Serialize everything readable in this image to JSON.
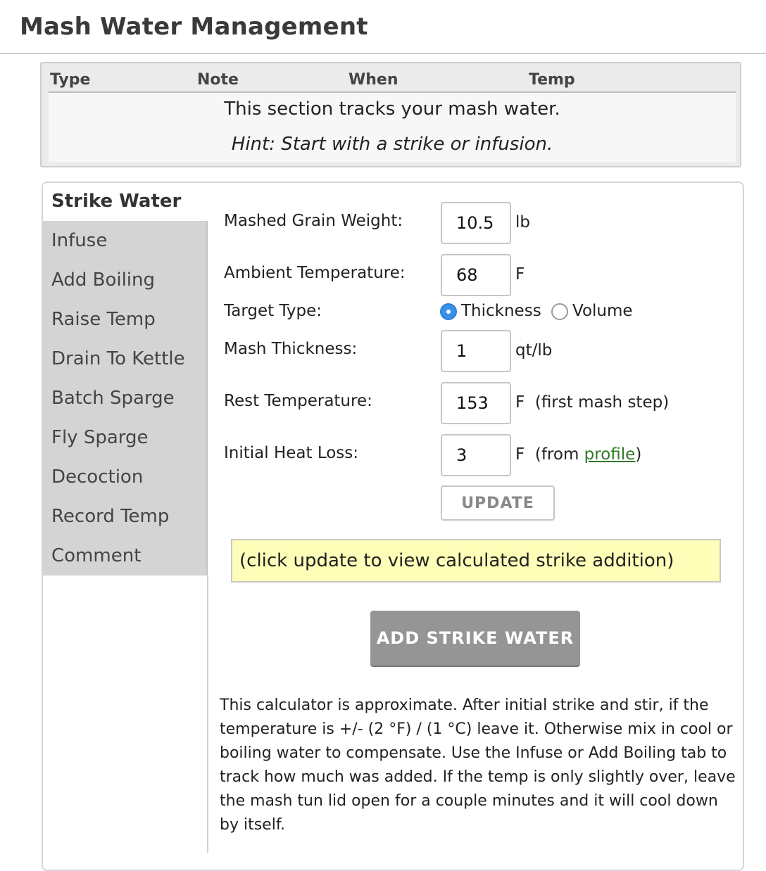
{
  "page": {
    "title": "Mash Water Management"
  },
  "log": {
    "columns": [
      "Type",
      "Note",
      "When",
      "Temp"
    ],
    "empty_message": "This section tracks your mash water.",
    "hint": "Hint: Start with a strike or infusion."
  },
  "tabs": {
    "active": "Strike Water",
    "items": [
      "Infuse",
      "Add Boiling",
      "Raise Temp",
      "Drain To Kettle",
      "Batch Sparge",
      "Fly Sparge",
      "Decoction",
      "Record Temp",
      "Comment"
    ]
  },
  "form": {
    "grain_weight": {
      "label": "Mashed Grain Weight:",
      "value": "10.5",
      "unit": "lb"
    },
    "ambient_temp": {
      "label": "Ambient Temperature:",
      "value": "68",
      "unit": "F"
    },
    "target_type": {
      "label": "Target Type:",
      "option_thickness": "Thickness",
      "option_volume": "Volume",
      "selected": "Thickness"
    },
    "mash_thickness": {
      "label": "Mash Thickness:",
      "value": "1",
      "unit": "qt/lb"
    },
    "rest_temp": {
      "label": "Rest Temperature:",
      "value": "153",
      "unit": "F  (first mash step)"
    },
    "heat_loss": {
      "label": "Initial Heat Loss:",
      "value": "3",
      "unit_prefix": "F  (from ",
      "link_text": "profile",
      "unit_suffix": ")"
    },
    "update_label": "UPDATE"
  },
  "result": {
    "placeholder_text": "(click update to view calculated strike addition)"
  },
  "actions": {
    "add_label": "ADD STRIKE WATER"
  },
  "note": "This calculator is approximate. After initial strike and stir, if the temperature is +/- (2 °F) / (1 °C) leave it. Otherwise mix in cool or boiling water to compensate. Use the Infuse or Add Boiling tab to track how much was added. If the temp is only slightly over, leave the mash tun lid open for a couple minutes and it will cool down by itself.",
  "colors": {
    "selected_radio": "#3b8fe8",
    "link": "#2f7a26",
    "result_bg": "#fefeb8",
    "add_button": "#959595"
  }
}
